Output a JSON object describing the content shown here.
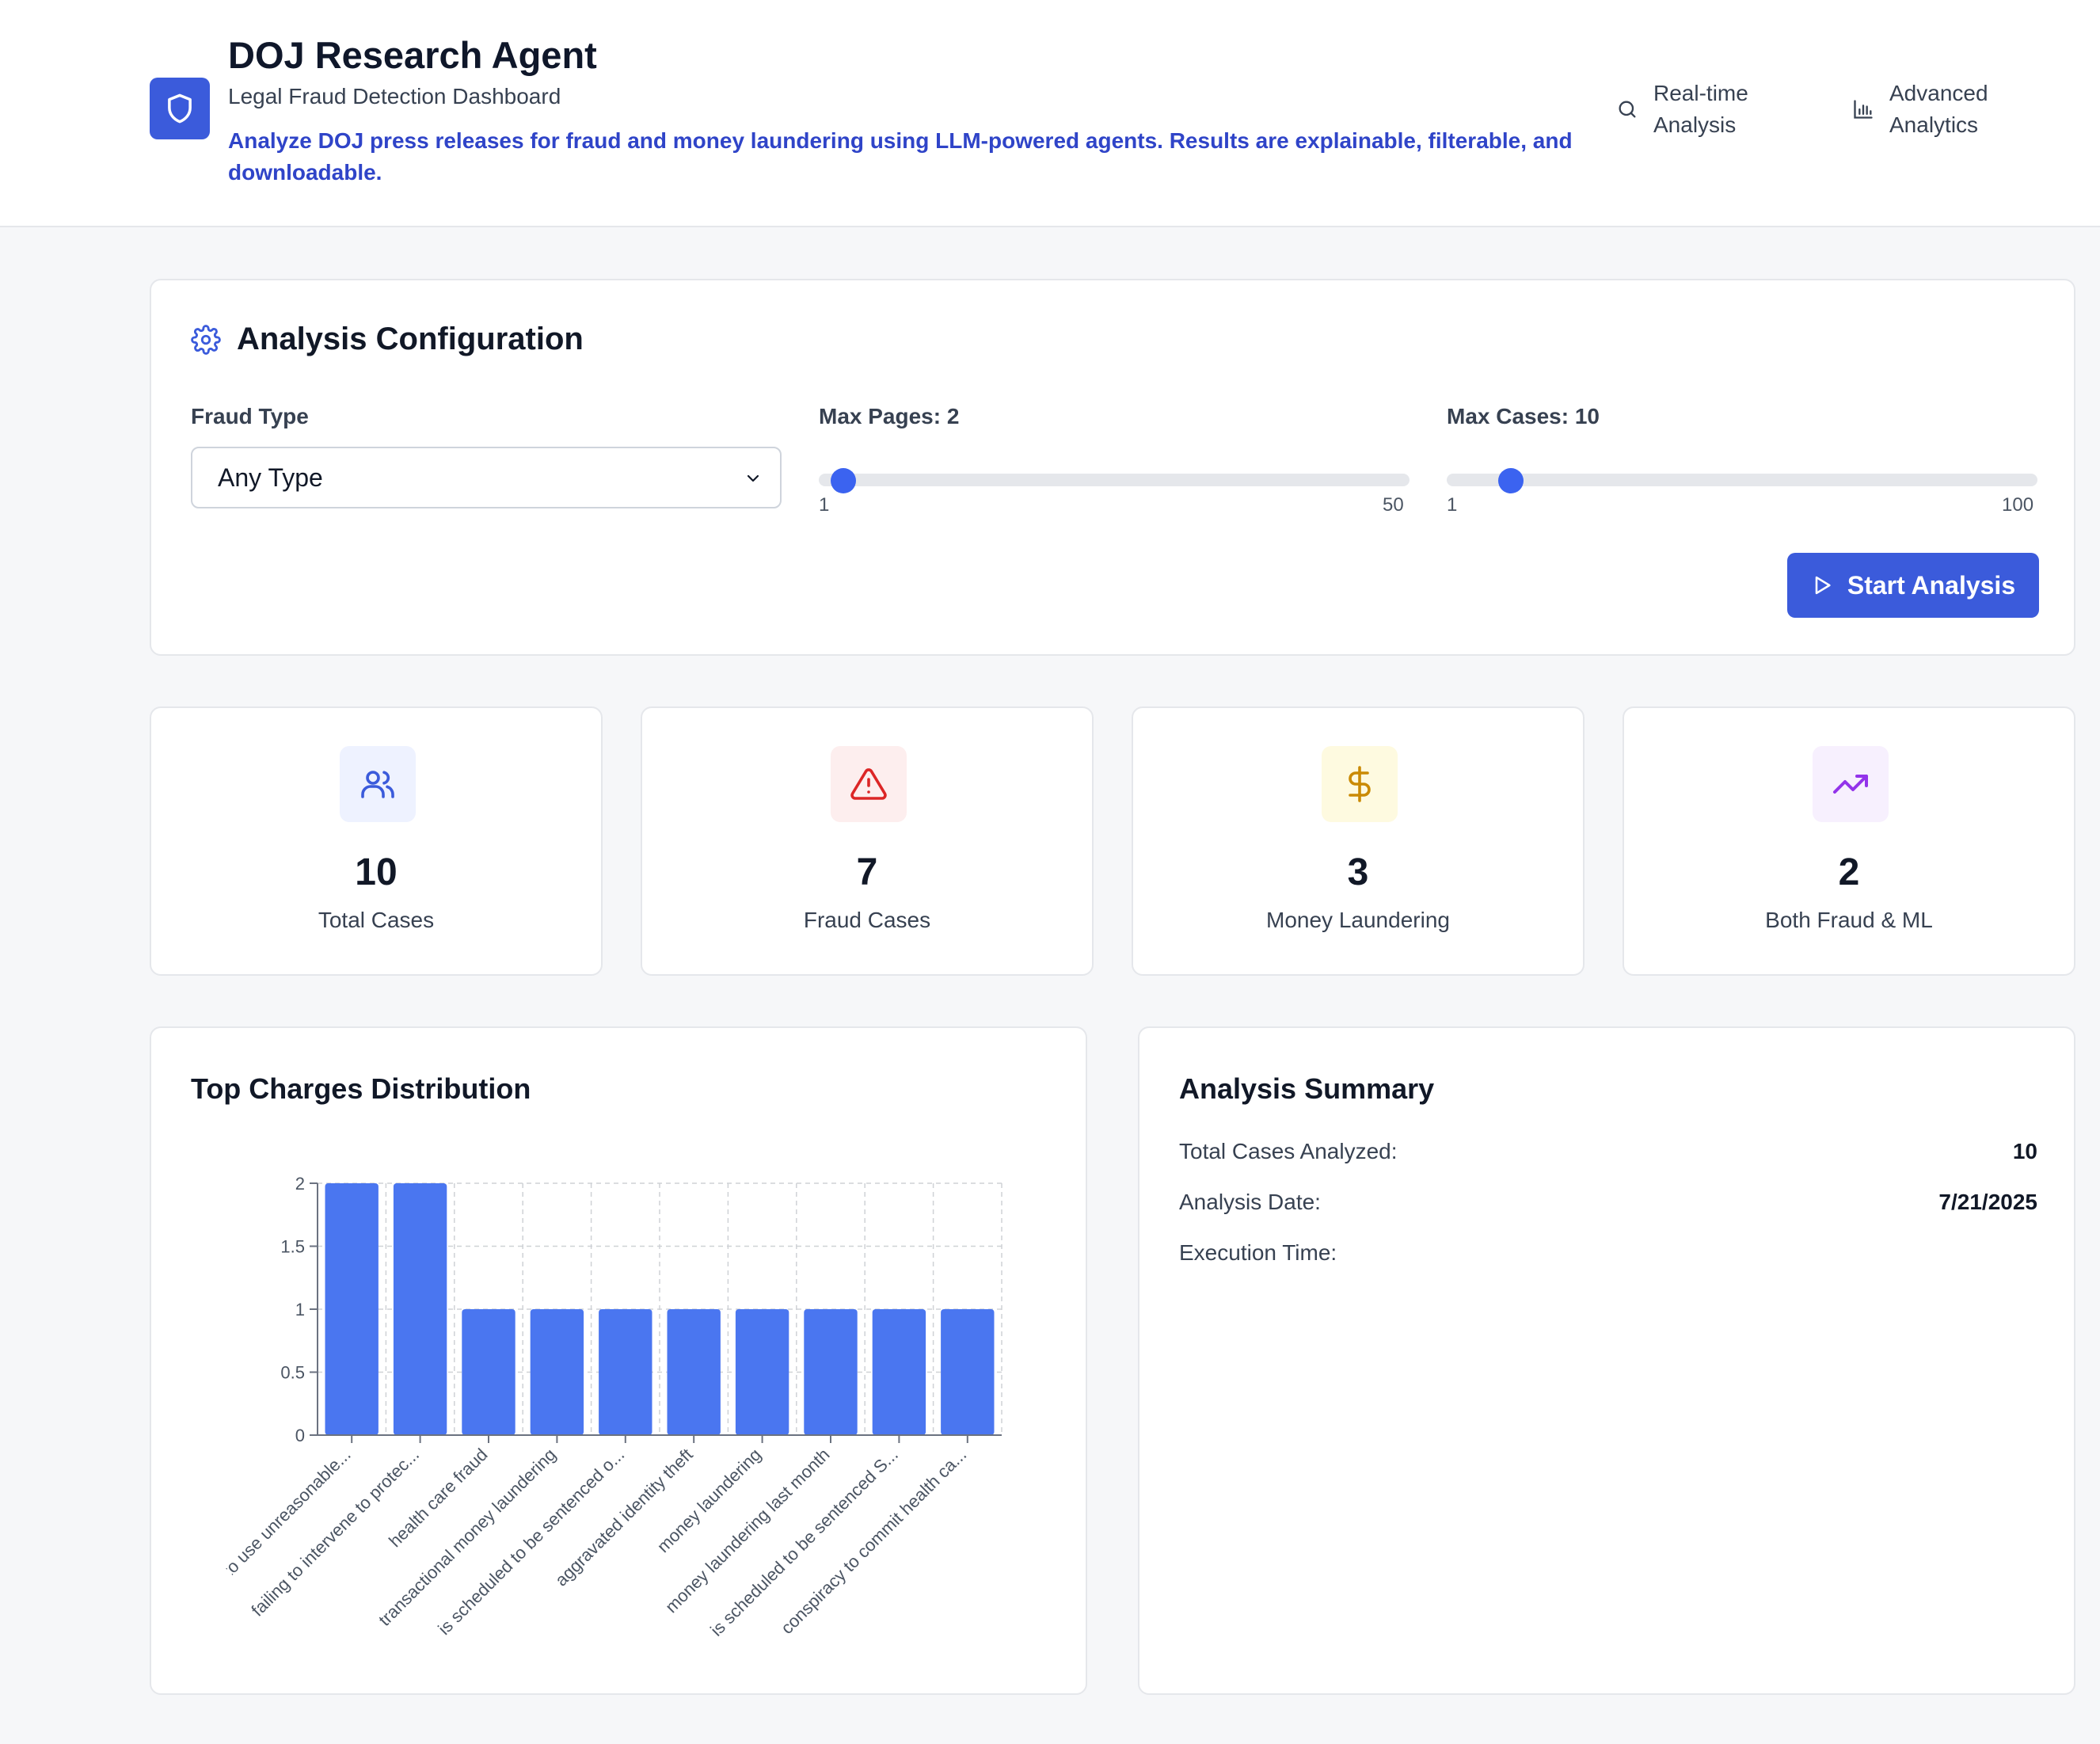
{
  "header": {
    "title": "DOJ Research Agent",
    "subtitle": "Legal Fraud Detection Dashboard",
    "description": "Analyze DOJ press releases for fraud and money laundering using LLM-powered agents. Results are explainable, filterable, and downloadable.",
    "features": [
      {
        "label": "Real-time Analysis",
        "icon": "search-icon"
      },
      {
        "label": "Advanced Analytics",
        "icon": "bar-chart-icon"
      }
    ],
    "logo_icon": "shield-icon",
    "accent_color": "#3b5bdb"
  },
  "config": {
    "title": "Analysis Configuration",
    "title_icon": "gear-icon",
    "fraud_type_label": "Fraud Type",
    "fraud_type_value": "Any Type",
    "max_pages_label": "Max Pages: 2",
    "max_pages": {
      "value": 2,
      "min": 1,
      "max": 50,
      "min_label": "1",
      "max_label": "50"
    },
    "max_cases_label": "Max Cases: 10",
    "max_cases": {
      "value": 10,
      "min": 1,
      "max": 100,
      "min_label": "1",
      "max_label": "100"
    },
    "start_button": "Start Analysis",
    "start_icon": "play-icon"
  },
  "stats": [
    {
      "value": "10",
      "label": "Total Cases",
      "icon": "users-icon",
      "color": "#3b5bdb",
      "bg": "#eef2ff"
    },
    {
      "value": "7",
      "label": "Fraud Cases",
      "icon": "warning-icon",
      "color": "#dc2626",
      "bg": "#fdeeee"
    },
    {
      "value": "3",
      "label": "Money Laundering",
      "icon": "dollar-icon",
      "color": "#ca8a04",
      "bg": "#fefae0"
    },
    {
      "value": "2",
      "label": "Both Fraud & ML",
      "icon": "trending-up-icon",
      "color": "#9333ea",
      "bg": "#f7f0fe"
    }
  ],
  "chart_title": "Top Charges Distribution",
  "chart_data": {
    "type": "bar",
    "categories": [
      "ing to use unreasonable...",
      "failing to intervene to protec...",
      "health care fraud",
      "transactional money laundering",
      "is scheduled to be sentenced o...",
      "aggravated identity theft",
      "money laundering",
      "money laundering last month",
      "is scheduled to be sentenced S...",
      "conspiracy to commit health ca..."
    ],
    "values": [
      2,
      2,
      1,
      1,
      1,
      1,
      1,
      1,
      1,
      1
    ],
    "ylim": [
      0,
      2
    ],
    "yticks": [
      "0",
      "0.5",
      "1",
      "1.5",
      "2"
    ],
    "grid": true,
    "color": "#4a76f0"
  },
  "summary": {
    "title": "Analysis Summary",
    "rows": [
      {
        "label": "Total Cases Analyzed:",
        "value": "10"
      },
      {
        "label": "Analysis Date:",
        "value": "7/21/2025"
      },
      {
        "label": "Execution Time:",
        "value": ""
      }
    ]
  }
}
